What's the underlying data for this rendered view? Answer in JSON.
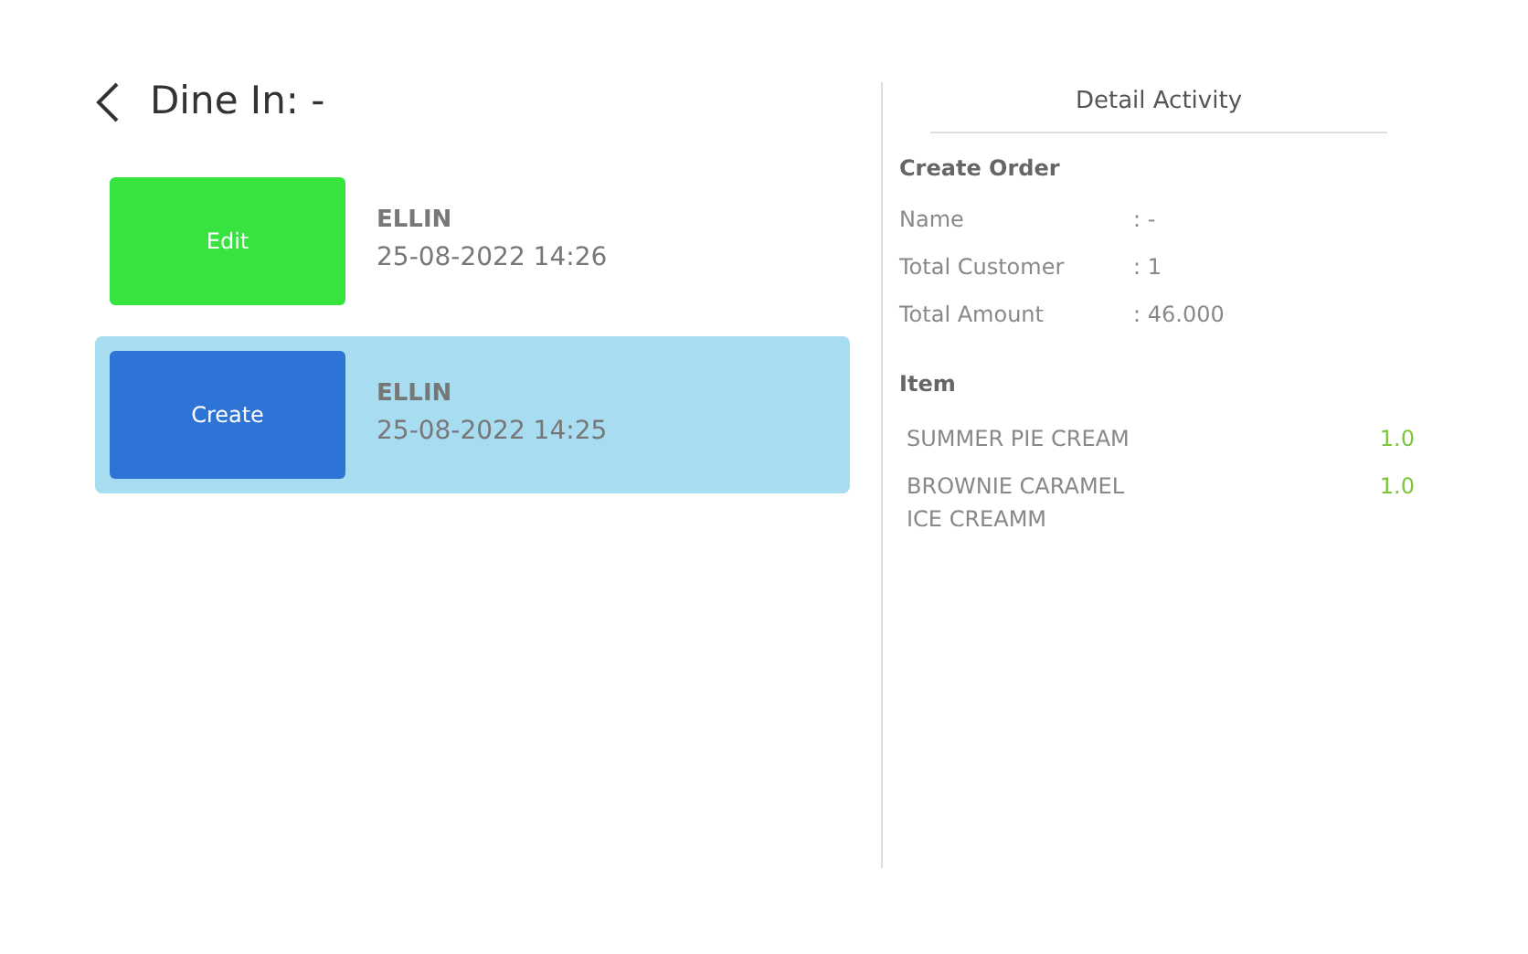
{
  "header": {
    "title": "Dine In: -"
  },
  "activities": [
    {
      "kind": "edit",
      "label": "Edit",
      "user": "ELLIN",
      "time": "25-08-2022 14:26",
      "selected": false
    },
    {
      "kind": "create",
      "label": "Create",
      "user": "ELLIN",
      "time": "25-08-2022 14:25",
      "selected": true
    }
  ],
  "detail": {
    "title": "Detail Activity",
    "section": "Create Order",
    "fields": [
      {
        "label": "Name",
        "value": ": -"
      },
      {
        "label": "Total Customer",
        "value": ": 1"
      },
      {
        "label": "Total Amount",
        "value": ": 46.000"
      }
    ],
    "items_heading": "Item",
    "items": [
      {
        "name": "SUMMER PIE CREAM",
        "qty": "1.0"
      },
      {
        "name": "BROWNIE CARAMEL ICE CREAMM",
        "qty": "1.0"
      }
    ]
  }
}
